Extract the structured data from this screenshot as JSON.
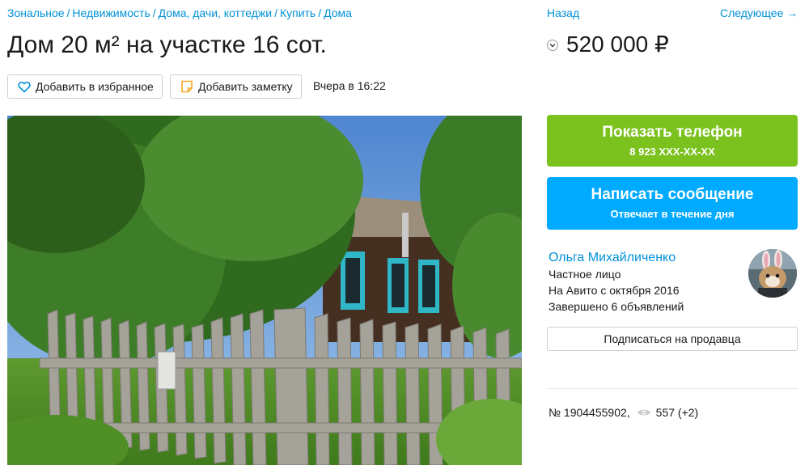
{
  "breadcrumbs": [
    {
      "label": "Зональное"
    },
    {
      "label": "Недвижимость"
    },
    {
      "label": "Дома, дачи, коттеджи"
    },
    {
      "label": "Купить"
    },
    {
      "label": "Дома"
    }
  ],
  "breadcrumb_separator": "/",
  "title": "Дом 20 м² на участке 16 сот.",
  "actions": {
    "favorite_label": "Добавить в избранное",
    "note_label": "Добавить заметку",
    "posted": "Вчера в 16:22"
  },
  "nav": {
    "back_label": "Назад",
    "next_label": "Следующее →"
  },
  "price": "520 000 ₽",
  "phone_button": {
    "label": "Показать телефон",
    "number": "8 923 XXX-XX-XX",
    "color": "#7cc21f"
  },
  "message_button": {
    "label": "Написать сообщение",
    "sub": "Отвечает в течение дня",
    "color": "#00aaff"
  },
  "seller": {
    "name": "Ольга Михайличенко",
    "type": "Частное лицо",
    "since": "На Авито с октября 2016",
    "completed": "Завершено 6 объявлений"
  },
  "subscribe_label": "Подписаться на продавца",
  "listing": {
    "id": "№ 1904455902,",
    "views": "557 (+2)"
  },
  "colors": {
    "link": "#0091d9",
    "text": "#1a1a1a"
  },
  "icons": [
    "heart-icon",
    "note-icon",
    "chevron-down-icon",
    "eye-icon"
  ]
}
